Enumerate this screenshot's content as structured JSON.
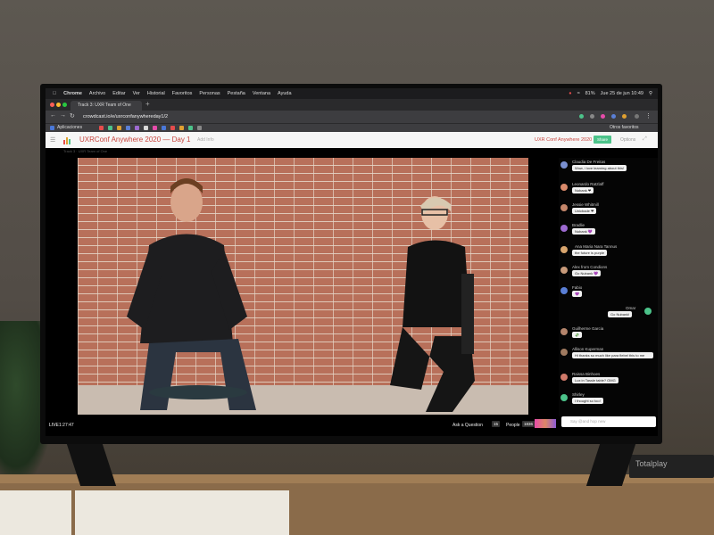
{
  "menubar": {
    "app": "Chrome",
    "items": [
      "Archivo",
      "Editar",
      "Ver",
      "Historial",
      "Favoritos",
      "Personas",
      "Pestaña",
      "Ventana",
      "Ayuda"
    ],
    "battery": "81%",
    "datetime": "Jue 25 de jun 10:49"
  },
  "browser": {
    "tab_title": "Track 3: UXR Team of One",
    "url": "crowdcast.io/e/uxrconfanywhereday1/2",
    "bookmarks_label": "Aplicaciones",
    "other_bookmarks": "Otros favoritos"
  },
  "app_header": {
    "event_title": "UXRConf Anywhere 2020 — Day 1",
    "event_sub": "Add Info",
    "organizer": "UXR Conf Anywhere 2020",
    "share_label": "Share",
    "link_label": "Options",
    "crumbs": "Track 3 · UXR Team of One"
  },
  "chat": {
    "messages": [
      {
        "name": "Claudia De Freitas",
        "text": "Wow, i love learning about this!",
        "color": "#7a8fd0"
      },
      {
        "name": "Leonardo Ratzlaff",
        "text": "Nobank ❤",
        "color": "#d98a6b"
      },
      {
        "name": "Jessie Whitmill",
        "text": "Unicbade ❤",
        "color": "#c4866a"
      },
      {
        "name": "Bradlie",
        "text": "Nubank 💜",
        "color": "#9d6ad1"
      },
      {
        "name": "Ana Maria Nara Tannus",
        "text": "the future is purple",
        "color": "#d8a56e"
      },
      {
        "name": "Alex from Condions",
        "text": "Go Nubank 💜",
        "color": "#c89a7a"
      },
      {
        "name": "Fabio",
        "text": "💜",
        "color": "#5a7fd6"
      },
      {
        "name": "Omar",
        "text": "Go Nubank!",
        "color": "#4cc38a"
      },
      {
        "name": "Guilherme Garcia",
        "text": "💸",
        "color": "#b5856c"
      },
      {
        "name": "Allison Kuperman",
        "text": "Hi thanks so much like para fiebel this to me",
        "color": "#a07a60"
      },
      {
        "name": "Raissa Binhoes",
        "text": "Lux in Tassle table? OMG",
        "color": "#d07a6a"
      },
      {
        "name": "Shirley",
        "text": "I thought so too!",
        "color": "#4cc38a"
      }
    ],
    "input_placeholder": "Say @and hop new"
  },
  "bottom": {
    "live_label": "LIVE",
    "elapsed": "1:27:47",
    "ask_label": "Ask a Question",
    "ask_count": "15",
    "people_label": "People",
    "people_count": "1836"
  },
  "device_label": "Totalplay",
  "colors": {
    "brand_red": "#c8453e",
    "share_green": "#4cc38a"
  }
}
